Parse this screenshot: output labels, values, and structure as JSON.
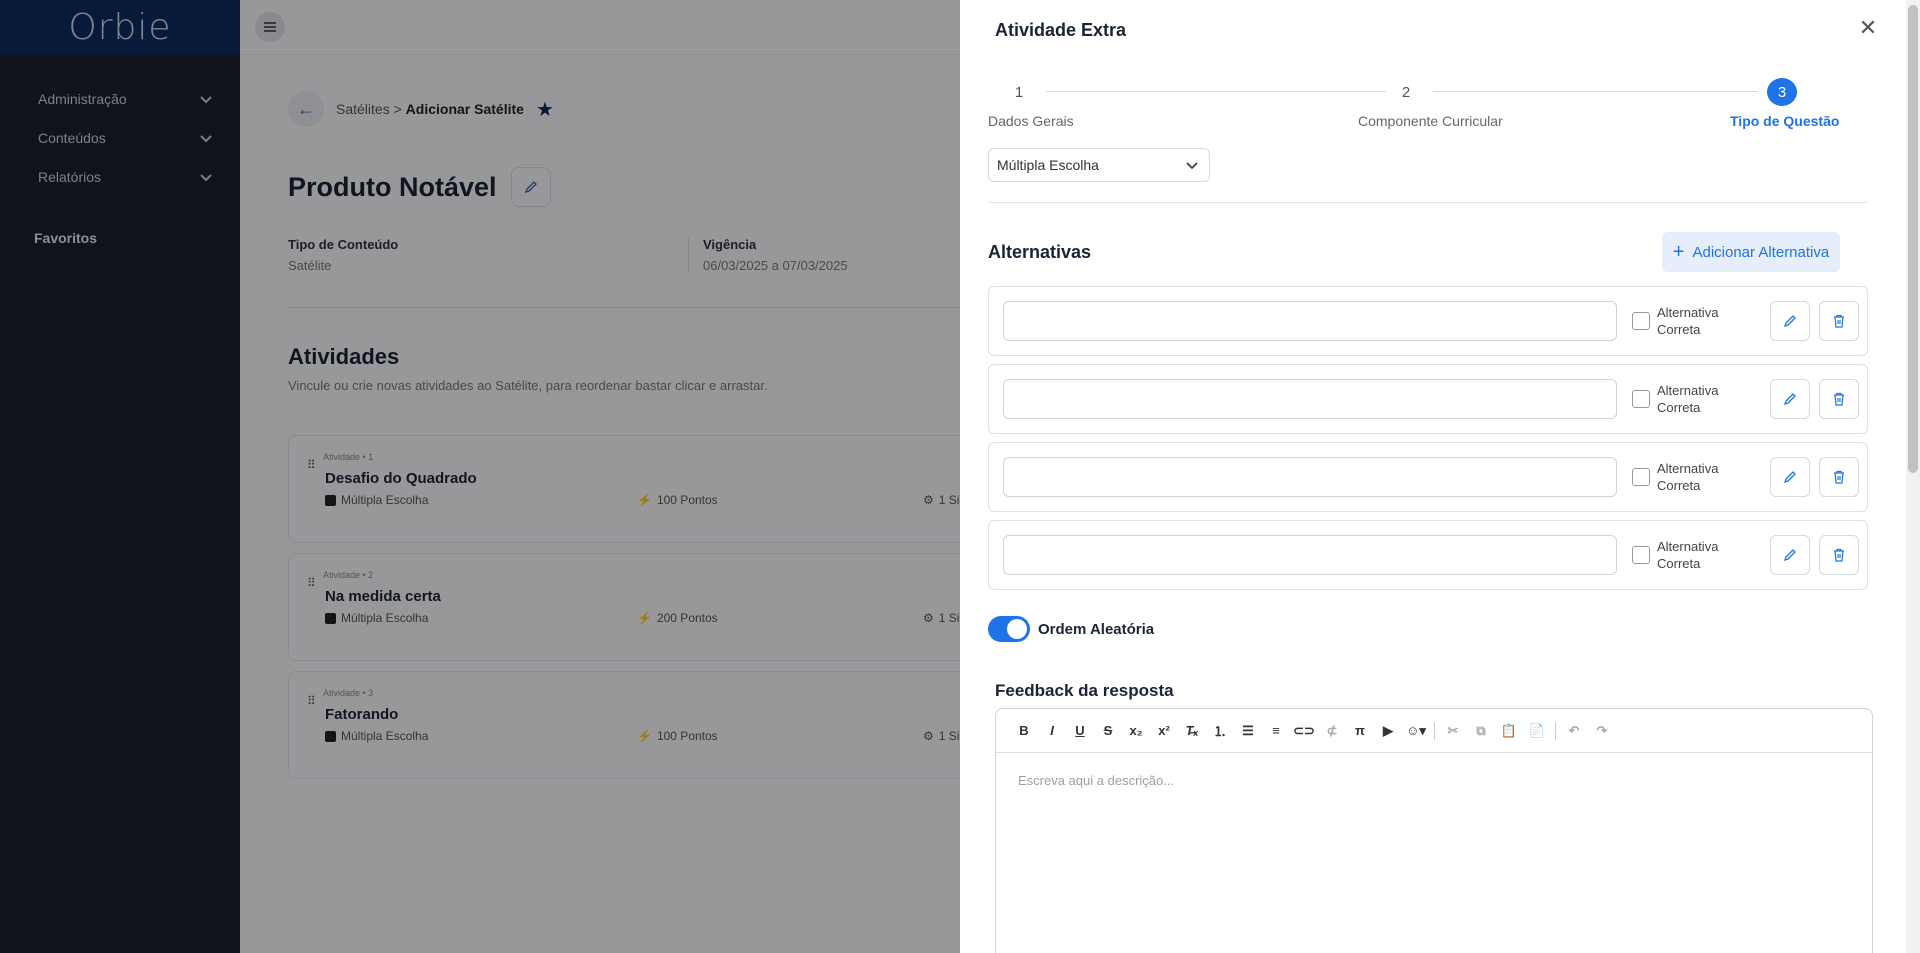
{
  "sidebar": {
    "logo": "Orbie",
    "items": [
      {
        "label": "Administração"
      },
      {
        "label": "Conteúdos"
      },
      {
        "label": "Relatórios"
      }
    ],
    "favorites": "Favoritos"
  },
  "page": {
    "breadcrumb_parent": "Satélites",
    "breadcrumb_sep": ">",
    "breadcrumb_current": "Adicionar Satélite",
    "title": "Produto Notável",
    "meta": [
      {
        "label": "Tipo de Conteúdo",
        "value": "Satélite"
      },
      {
        "label": "Vigência",
        "value": "06/03/2025 a 07/03/2025"
      }
    ],
    "activities_title": "Atividades",
    "activities_desc": "Vincule ou crie novas atividades ao Satélite, para reordenar bastar clicar e arrastar.",
    "activities": [
      {
        "tag": "Atividade • 1",
        "title": "Desafio do Quadrado",
        "type": "Múltipla Escolha",
        "points": "100 Pontos",
        "extra": "1 Si"
      },
      {
        "tag": "Atividade • 2",
        "title": "Na medida certa",
        "type": "Múltipla Escolha",
        "points": "200 Pontos",
        "extra": "1 Si"
      },
      {
        "tag": "Atividade • 3",
        "title": "Fatorando",
        "type": "Múltipla Escolha",
        "points": "100 Pontos",
        "extra": "1 Si"
      }
    ]
  },
  "drawer": {
    "title": "Atividade Extra",
    "steps": [
      {
        "num": "1",
        "label": "Dados Gerais"
      },
      {
        "num": "2",
        "label": "Componente Curricular"
      },
      {
        "num": "3",
        "label": "Tipo de Questão"
      }
    ],
    "question_type": "Múltipla Escolha",
    "alternatives_title": "Alternativas",
    "add_alternative": "Adicionar Alternativa",
    "alternatives": [
      {
        "value": "",
        "correct_label": "Alternativa Correta"
      },
      {
        "value": "",
        "correct_label": "Alternativa Correta"
      },
      {
        "value": "",
        "correct_label": "Alternativa Correta"
      },
      {
        "value": "",
        "correct_label": "Alternativa Correta"
      }
    ],
    "random_order_label": "Ordem Aleatória",
    "feedback_title": "Feedback da resposta",
    "feedback_placeholder": "Escreva aqui a descrição..."
  },
  "colors": {
    "accent": "#1e74e6",
    "sidebar": "#1b1f2a",
    "sidebar_top": "#0d2a5e"
  }
}
